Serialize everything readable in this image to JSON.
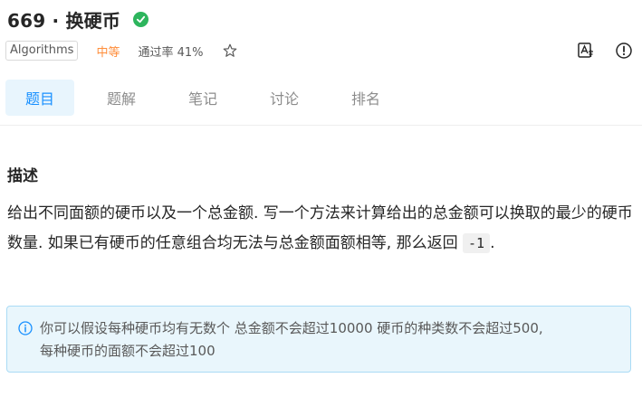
{
  "problem": {
    "title": "669 · 换硬币",
    "tag": "Algorithms",
    "difficulty": "中等",
    "pass_rate": "通过率 41%"
  },
  "tabs": [
    {
      "label": "题目",
      "active": true
    },
    {
      "label": "题解",
      "active": false
    },
    {
      "label": "笔记",
      "active": false
    },
    {
      "label": "讨论",
      "active": false
    },
    {
      "label": "排名",
      "active": false
    }
  ],
  "description": {
    "heading": "描述",
    "text": "给出不同面额的硬币以及一个总金额. 写一个方法来计算给出的总金额可以换取的最少的硬币数量. 如果已有硬币的任意组合均无法与总金额面额相等, 那么返回",
    "code": "-1",
    "suffix": "."
  },
  "note": {
    "line1": "你可以假设每种硬币均有无数个 总金额不会超过10000 硬币的种类数不会超过500,",
    "line2": "每种硬币的面额不会超过100"
  },
  "colors": {
    "accent": "#1890ff",
    "difficulty": "#ff8d3a",
    "verified": "#2db55d",
    "note_bg": "#e9f6fc"
  },
  "icons": {
    "verified": "check-circle-icon",
    "star": "star-icon",
    "translate": "translate-icon",
    "report": "info-circle-icon",
    "note": "info-icon"
  }
}
